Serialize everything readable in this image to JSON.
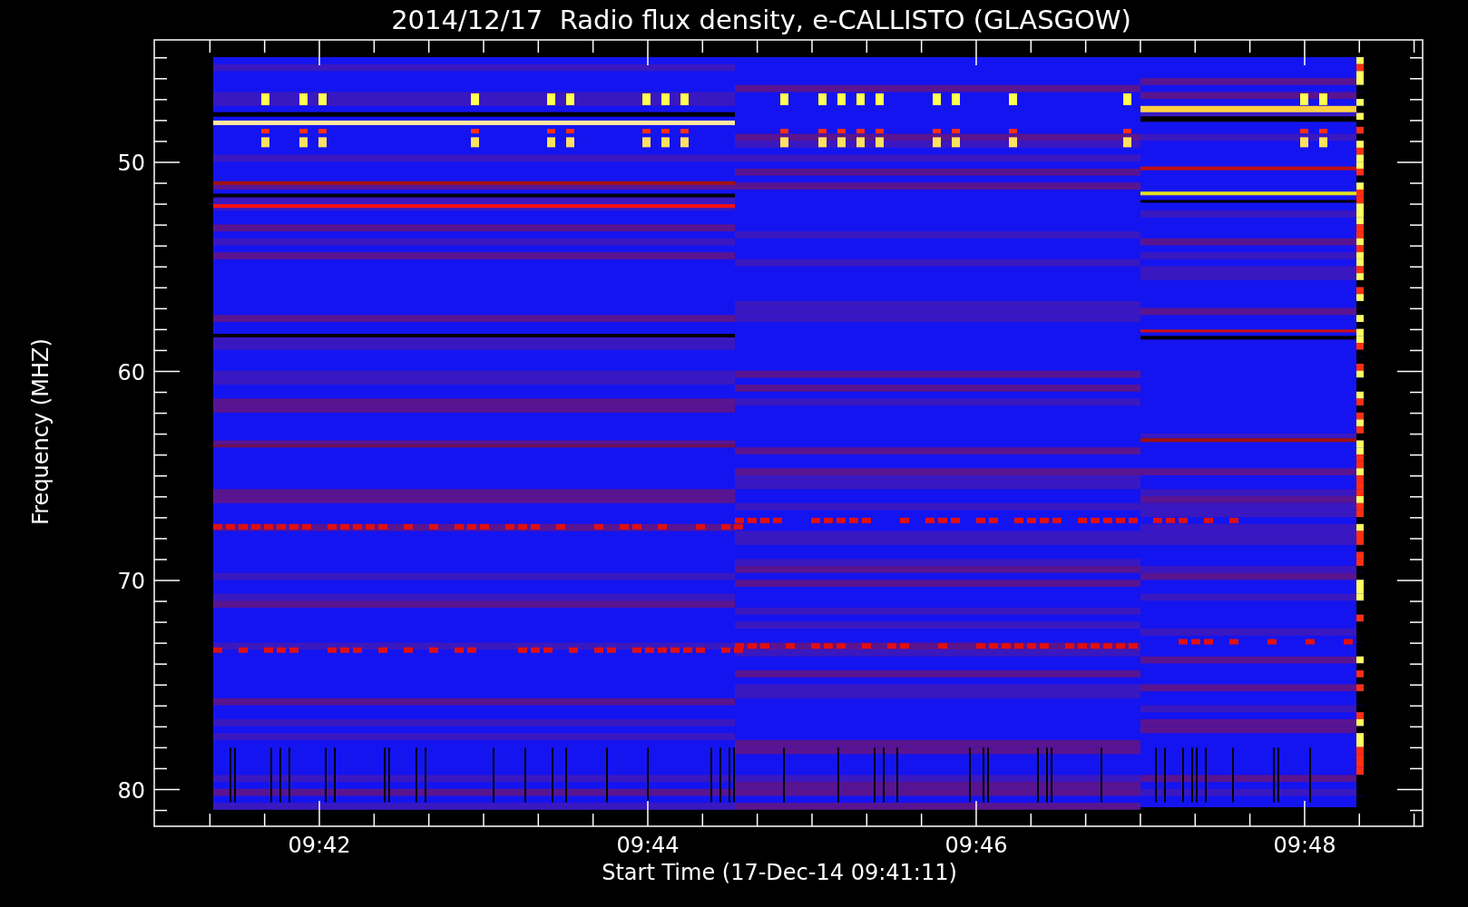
{
  "title": "2014/12/17  Radio flux density, e-CALLISTO (GLASGOW)",
  "y_axis": {
    "label": "Frequency (MHZ)",
    "ticks": [
      "50",
      "60",
      "70",
      "80"
    ]
  },
  "x_axis": {
    "label": "Start Time (17-Dec-14 09:41:11)",
    "ticks": [
      "09:42",
      "09:44",
      "09:46",
      "09:48"
    ]
  }
}
